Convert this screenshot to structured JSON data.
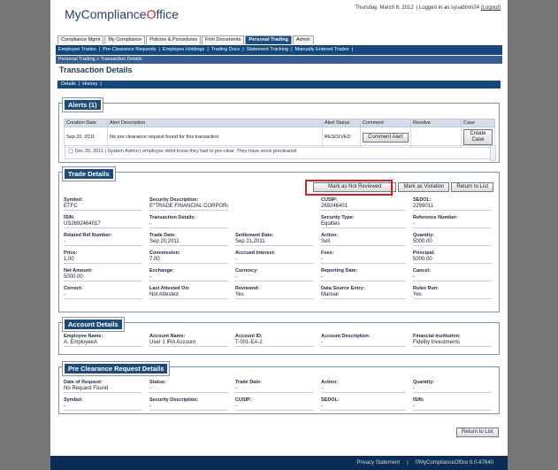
{
  "header": {
    "logo_text": "MyCompliance",
    "logo_mark": "O",
    "logo_suffix": "ffice",
    "date": "Thursday, March 8, 2012",
    "logged_as": "| Logged in as sysadmin24",
    "logout": "(Logout)"
  },
  "main_tabs": [
    "Compliance Mgmt",
    "My Compliance",
    "Policies & Procedures",
    "Firm Documents",
    "Personal Trading",
    "Admin"
  ],
  "active_tab": "Personal Trading",
  "sub_nav": [
    "Employee Trades",
    "|",
    "Pre-Clearance Requests",
    "|",
    "Employee Holdings",
    "|",
    "Trading Docs",
    "|",
    "Statement Tracking",
    "|",
    "Manually Entered Trades",
    "|"
  ],
  "breadcrumb": "Personal Trading » Transaction Details",
  "page_title": "Transaction Details",
  "detail_tabs": [
    "Details",
    "|",
    "History",
    "|"
  ],
  "alerts": {
    "title": "Alerts (1)",
    "columns": [
      "Creation Date",
      "Alert Description",
      "Alert Status",
      "Comment",
      "Resolve",
      "Case"
    ],
    "row": {
      "date": "Sep 20, 2011",
      "description": "No pre clearance request found for this transaction",
      "status": "RESOLVED",
      "comment_btn": "Comment Alert",
      "case_btn": "Create Case"
    },
    "note": "Dec 20, 2011 | System Admin | employee didnt know they had to pre-clear. They have since precleared"
  },
  "trade": {
    "title": "Trade Details",
    "btn_not_reviewed": "Mark as Not Reviewed",
    "btn_violation": "Mark as Violation",
    "btn_return": "Return to List",
    "fields": [
      {
        "label": "Symbol:",
        "value": "ETFC"
      },
      {
        "label": "Security Description:",
        "value": "E*TRADE FINANCIAL CORPORATION"
      },
      {
        "label": "",
        "value": ""
      },
      {
        "label": "CUSIP:",
        "value": "269246401"
      },
      {
        "label": "SEDOL:",
        "value": "2299011"
      },
      {
        "label": "ISIN:",
        "value": "US2692464017"
      },
      {
        "label": "Transaction Details:",
        "value": "-"
      },
      {
        "label": "",
        "value": ""
      },
      {
        "label": "Security Type:",
        "value": "Equities"
      },
      {
        "label": "Reference Number:",
        "value": "-"
      },
      {
        "label": "Related Ref Number:",
        "value": "-"
      },
      {
        "label": "Trade Date:",
        "value": "Sep 20,2011"
      },
      {
        "label": "Settlement Date:",
        "value": "Sep 21,2011"
      },
      {
        "label": "Action:",
        "value": "Sell"
      },
      {
        "label": "Quantity:",
        "value": "5000.00"
      },
      {
        "label": "Price:",
        "value": "1.00"
      },
      {
        "label": "Commission:",
        "value": "7.00"
      },
      {
        "label": "Accrued Interest:",
        "value": "-"
      },
      {
        "label": "Fees:",
        "value": "-"
      },
      {
        "label": "Principal:",
        "value": "5000.00"
      },
      {
        "label": "Net Amount:",
        "value": "5000.00"
      },
      {
        "label": "Exchange:",
        "value": "-"
      },
      {
        "label": "Currency:",
        "value": "-"
      },
      {
        "label": "Reporting Date:",
        "value": "-"
      },
      {
        "label": "Cancel:",
        "value": "-"
      },
      {
        "label": "Correct:",
        "value": "-"
      },
      {
        "label": "Last Attested On:",
        "value": "Not Attested"
      },
      {
        "label": "Reviewed:",
        "value": "Yes"
      },
      {
        "label": "Data Source Entry:",
        "value": "Manual"
      },
      {
        "label": "Rules Run:",
        "value": "Yes"
      }
    ]
  },
  "account": {
    "title": "Account Details",
    "fields": [
      {
        "label": "Employee Name:",
        "value": "A. EmployeeA"
      },
      {
        "label": "Account Name:",
        "value": "User 1 IRA Account"
      },
      {
        "label": "Account ID:",
        "value": "T-001-EA-2"
      },
      {
        "label": "Account Description:",
        "value": "-"
      },
      {
        "label": "Financial Institution:",
        "value": "Fidelity Investments"
      }
    ]
  },
  "preclear": {
    "title": "Pre Clearance Request Details",
    "fields": [
      {
        "label": "Date of Request:",
        "value": "No Request Found"
      },
      {
        "label": "Status:",
        "value": "-"
      },
      {
        "label": "Trade Date:",
        "value": "-"
      },
      {
        "label": "Action:",
        "value": "-"
      },
      {
        "label": "Quantity:",
        "value": "-"
      },
      {
        "label": "Symbol:",
        "value": "-"
      },
      {
        "label": "Security Description:",
        "value": "-"
      },
      {
        "label": "CUSIP:",
        "value": "-"
      },
      {
        "label": "SEDOL:",
        "value": "-"
      },
      {
        "label": "ISIN:",
        "value": "-"
      }
    ]
  },
  "bottom_return": "Return to List",
  "footer": {
    "privacy": "Privacy Statement",
    "sep": "|",
    "copyright": "©MyComplianceOffice 6.0-87640"
  },
  "colors": {
    "nav": "#14477a",
    "panel_header": "#1d4b7c",
    "highlight": "#d81f1f",
    "background": "#757575"
  }
}
